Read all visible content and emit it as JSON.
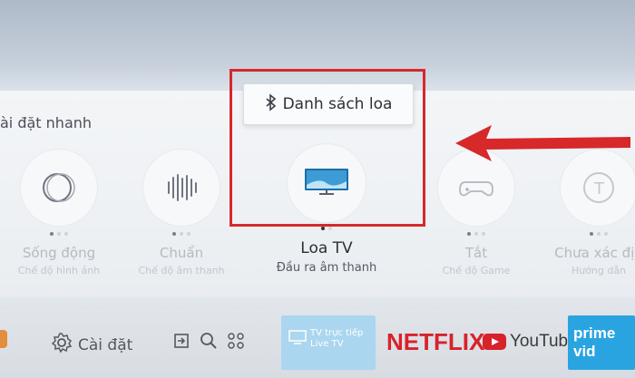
{
  "quick_settings": {
    "title": "ài đặt nhanh",
    "items": [
      {
        "label": "Sống động",
        "sub": "Chế độ hình ảnh",
        "icon": "circle-rings-icon"
      },
      {
        "label": "Chuẩn",
        "sub": "Chế độ âm thanh",
        "icon": "sound-bars-icon"
      },
      {
        "label": "Loa TV",
        "sub": "Đầu ra âm thanh",
        "icon": "tv-speaker-icon",
        "active": true
      },
      {
        "label": "Tắt",
        "sub": "Chế độ Game",
        "icon": "gamepad-icon"
      },
      {
        "label": "Chưa xác địn",
        "sub": "Hướng dẫn",
        "icon": "info-circle-icon"
      }
    ]
  },
  "popup": {
    "label": "Danh sách loa",
    "icon": "bluetooth-icon"
  },
  "annotation": {
    "box_color": "#d7282a",
    "arrow_color": "#d7282a"
  },
  "bottom_bar": {
    "settings_label": "Cài đặt",
    "tv_tile_text": "TV trực tiếp\nLive TV",
    "netflix": "NETFLIX",
    "youtube": "YouTube",
    "prime": "prime vid"
  }
}
